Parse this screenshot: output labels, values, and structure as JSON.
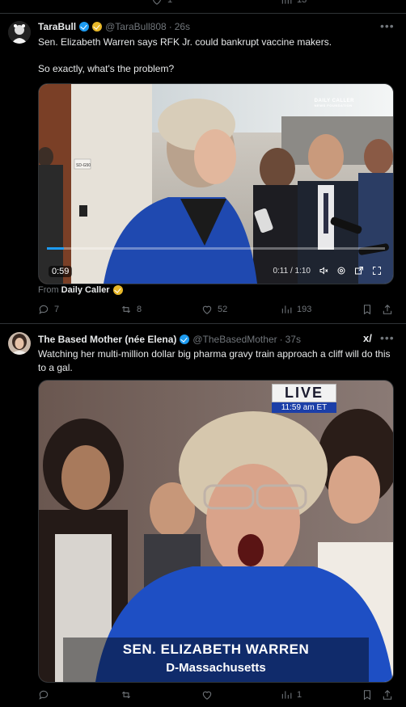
{
  "top_actions": {
    "reply": "",
    "repost": "",
    "like": "1",
    "views": "13"
  },
  "tweet1": {
    "name": "TaraBull",
    "handle": "@TaraBull808",
    "time": "26s",
    "text_line1": "Sen. Elizabeth Warren says RFK Jr. could bankrupt vaccine makers.",
    "text_line2": "So exactly, what's the problem?",
    "video": {
      "duration_badge": "0:59",
      "progress_time": "0:11 / 1:10",
      "watermark_line1": "DAILY CALLER",
      "watermark_line2": "NEWS FOUNDATION",
      "door_sign": "SD-G50",
      "progress_fraction": 0.05
    },
    "from_label": "From",
    "from_source": "Daily Caller",
    "actions": {
      "reply": "7",
      "repost": "8",
      "like": "52",
      "views": "193"
    }
  },
  "tweet2": {
    "name": "The Based Mother (née Elena)",
    "handle": "@TheBasedMother",
    "time": "37s",
    "grok_label": "x/",
    "text": "Watching her multi-million dollar big pharma gravy train approach a cliff will do this to a gal.",
    "image": {
      "live": "LIVE",
      "clock": "11:59 am ET",
      "caption_name": "SEN. ELIZABETH WARREN",
      "caption_state": "D-Massachusetts"
    },
    "actions": {
      "reply": "",
      "repost": "",
      "like": "",
      "views": "1"
    }
  },
  "colors": {
    "background": "#000000",
    "text": "#e7e9ea",
    "muted": "#71767b",
    "verified_blue": "#1d9bf0",
    "verified_gold": "#e8b829",
    "divider": "#2f3336"
  }
}
